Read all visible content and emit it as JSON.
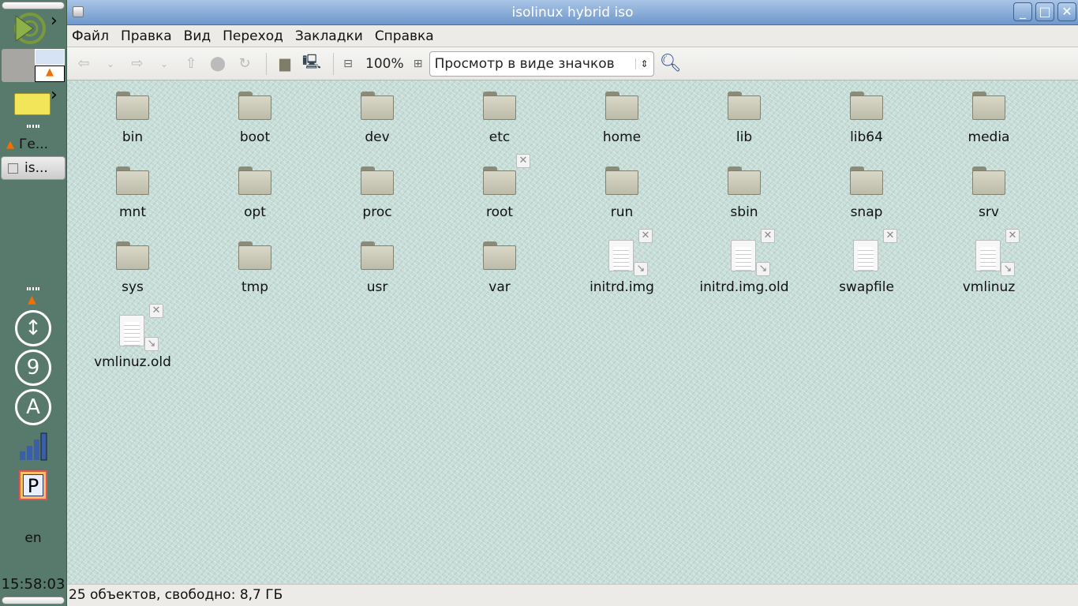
{
  "panel": {
    "tasks": [
      {
        "label": "Ге...",
        "icon": "vlc-icon"
      },
      {
        "label": "is...",
        "icon": "drive-icon"
      }
    ],
    "keyboard_layout": "en",
    "clock": "15:58:03",
    "tray": {
      "volume_digit": "9",
      "input_letter": "A",
      "clipboard_letter": "P"
    }
  },
  "window": {
    "title": "isolinux hybrid iso",
    "menu": [
      "Файл",
      "Правка",
      "Вид",
      "Переход",
      "Закладки",
      "Справка"
    ],
    "toolbar": {
      "zoom": "100%",
      "view_mode": "Просмотр в виде значков"
    },
    "items": [
      {
        "name": "bin",
        "type": "folder"
      },
      {
        "name": "boot",
        "type": "folder"
      },
      {
        "name": "dev",
        "type": "folder"
      },
      {
        "name": "etc",
        "type": "folder"
      },
      {
        "name": "home",
        "type": "folder"
      },
      {
        "name": "lib",
        "type": "folder"
      },
      {
        "name": "lib64",
        "type": "folder"
      },
      {
        "name": "media",
        "type": "folder"
      },
      {
        "name": "mnt",
        "type": "folder"
      },
      {
        "name": "opt",
        "type": "folder"
      },
      {
        "name": "proc",
        "type": "folder"
      },
      {
        "name": "root",
        "type": "folder",
        "locked": true
      },
      {
        "name": "run",
        "type": "folder"
      },
      {
        "name": "sbin",
        "type": "folder"
      },
      {
        "name": "snap",
        "type": "folder"
      },
      {
        "name": "srv",
        "type": "folder"
      },
      {
        "name": "sys",
        "type": "folder"
      },
      {
        "name": "tmp",
        "type": "folder"
      },
      {
        "name": "usr",
        "type": "folder"
      },
      {
        "name": "var",
        "type": "folder"
      },
      {
        "name": "initrd.img",
        "type": "file",
        "locked": true,
        "link": true
      },
      {
        "name": "initrd.img.old",
        "type": "file",
        "locked": true,
        "link": true
      },
      {
        "name": "swapfile",
        "type": "file",
        "locked": true
      },
      {
        "name": "vmlinuz",
        "type": "file",
        "locked": true,
        "link": true
      },
      {
        "name": "vmlinuz.old",
        "type": "file",
        "locked": true,
        "link": true
      }
    ],
    "status": "25 объектов, свободно: 8,7 ГБ"
  }
}
